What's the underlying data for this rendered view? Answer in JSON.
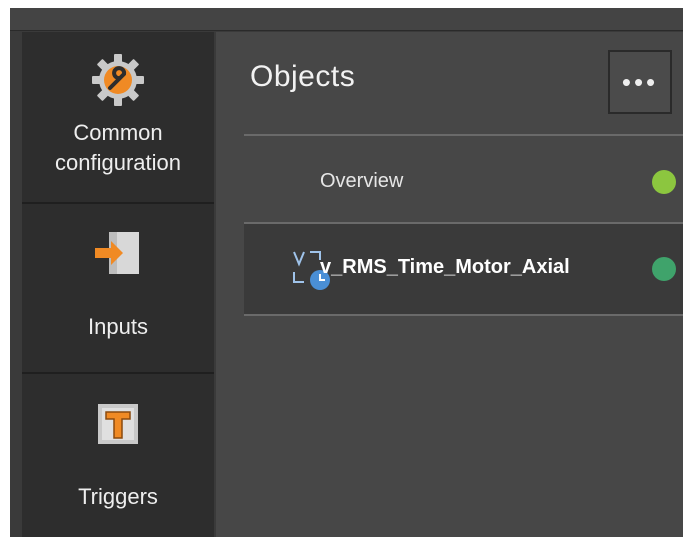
{
  "sidebar": {
    "items": [
      {
        "label": "Common configuration",
        "icon": "gear-wrench-icon"
      },
      {
        "label": "Inputs",
        "icon": "input-arrow-icon"
      },
      {
        "label": "Triggers",
        "icon": "trigger-t-icon"
      }
    ]
  },
  "main": {
    "title": "Objects",
    "more_label": "•••",
    "rows": [
      {
        "label": "Overview",
        "status_color": "#8cc63f"
      },
      {
        "label": "v_RMS_Time_Motor_Axial",
        "icon": "timer-variable-icon",
        "status_color": "#3fa36b"
      }
    ]
  },
  "colors": {
    "accent_orange": "#f08a24",
    "sidebar_bg": "#2d2d2d",
    "content_bg": "#474747",
    "selected_row_bg": "#3a3a3a"
  }
}
